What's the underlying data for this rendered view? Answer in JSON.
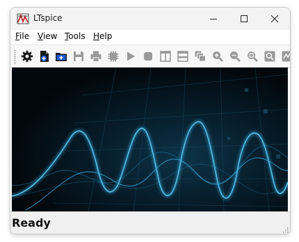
{
  "window": {
    "title": "LTspice",
    "app_icon": "ltspice-logo-icon",
    "controls": [
      "minimize-icon",
      "maximize-icon",
      "close-icon"
    ]
  },
  "menu": {
    "items": [
      {
        "label": "File",
        "mnemonic": "F"
      },
      {
        "label": "View",
        "mnemonic": "V"
      },
      {
        "label": "Tools",
        "mnemonic": "T"
      },
      {
        "label": "Help",
        "mnemonic": "H"
      }
    ]
  },
  "toolbar": {
    "buttons": [
      {
        "icon": "settings-gear-icon",
        "enabled": true
      },
      {
        "icon": "new-schematic-icon",
        "enabled": true
      },
      {
        "icon": "open-folder-icon",
        "enabled": true
      },
      {
        "icon": "save-icon",
        "enabled": false
      },
      {
        "icon": "print-icon",
        "enabled": false
      },
      {
        "icon": "chip-icon",
        "enabled": false
      },
      {
        "icon": "run-icon",
        "enabled": false
      },
      {
        "icon": "stop-icon",
        "enabled": false
      },
      {
        "icon": "tile-vertical-icon",
        "enabled": false
      },
      {
        "icon": "tile-horizontal-icon",
        "enabled": false
      },
      {
        "icon": "cascade-icon",
        "enabled": false
      },
      {
        "icon": "zoom-in-icon",
        "enabled": false
      },
      {
        "icon": "zoom-out-icon",
        "enabled": false
      },
      {
        "icon": "zoom-fit-icon",
        "enabled": false
      },
      {
        "icon": "zoom-area-icon",
        "enabled": false
      },
      {
        "icon": "autorange-icon",
        "enabled": false
      }
    ]
  },
  "status": {
    "text": "Ready"
  },
  "colors": {
    "titlebar_bg": "#f3f3f3",
    "canvas_bg": "#02080c",
    "wave_color": "#2fa3d6",
    "status_bg": "#f0f0f0",
    "icon_enabled": "#1a1a1a",
    "icon_disabled": "#9a9a9a"
  }
}
